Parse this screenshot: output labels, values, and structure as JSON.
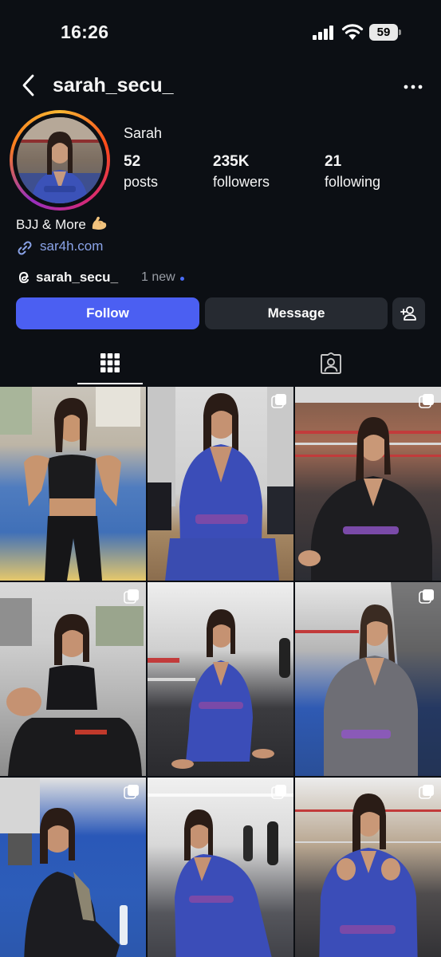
{
  "status_bar": {
    "time": "16:26",
    "battery": "59",
    "icons": [
      "signal-icon",
      "wifi-icon",
      "battery-icon"
    ]
  },
  "header": {
    "username": "sarah_secu_",
    "back_icon": "chevron-left-icon",
    "more_icon": "more-horizontal-icon"
  },
  "profile": {
    "display_name": "Sarah",
    "stats": [
      {
        "value": "52",
        "label": "posts"
      },
      {
        "value": "235K",
        "label": "followers"
      },
      {
        "value": "21",
        "label": "following"
      }
    ],
    "bio": "BJJ & More",
    "bio_emoji_icon": "flexed-biceps-icon",
    "link": "sar4h.com",
    "threads": {
      "name": "sarah_secu_",
      "badge": "1 new"
    }
  },
  "actions": {
    "follow": "Follow",
    "message": "Message",
    "add_user_icon": "add-user-icon"
  },
  "tabs": [
    {
      "name": "posts-grid",
      "icon": "grid-icon",
      "active": true
    },
    {
      "name": "tagged",
      "icon": "tagged-person-icon",
      "active": false
    }
  ],
  "posts": [
    {
      "scene": "gym with yellow and blue mats, black sports top",
      "multi": false
    },
    {
      "scene": "locker room, blue gi",
      "multi": true
    },
    {
      "scene": "boxing ring, black gi",
      "multi": true
    },
    {
      "scene": "gym mats, black sports top",
      "multi": true
    },
    {
      "scene": "training hall, blue gi kneeling",
      "multi": false
    },
    {
      "scene": "cage, grey gi",
      "multi": true
    },
    {
      "scene": "blue mats, black rashguard",
      "multi": true
    },
    {
      "scene": "training hall, blue gi seated",
      "multi": true
    },
    {
      "scene": "cage, blue gi fists up",
      "multi": true
    }
  ],
  "colors": {
    "background": "#0c0f14",
    "follow_button": "#4b5ff2",
    "secondary_button": "#262a31",
    "link": "#8aa3e8"
  }
}
